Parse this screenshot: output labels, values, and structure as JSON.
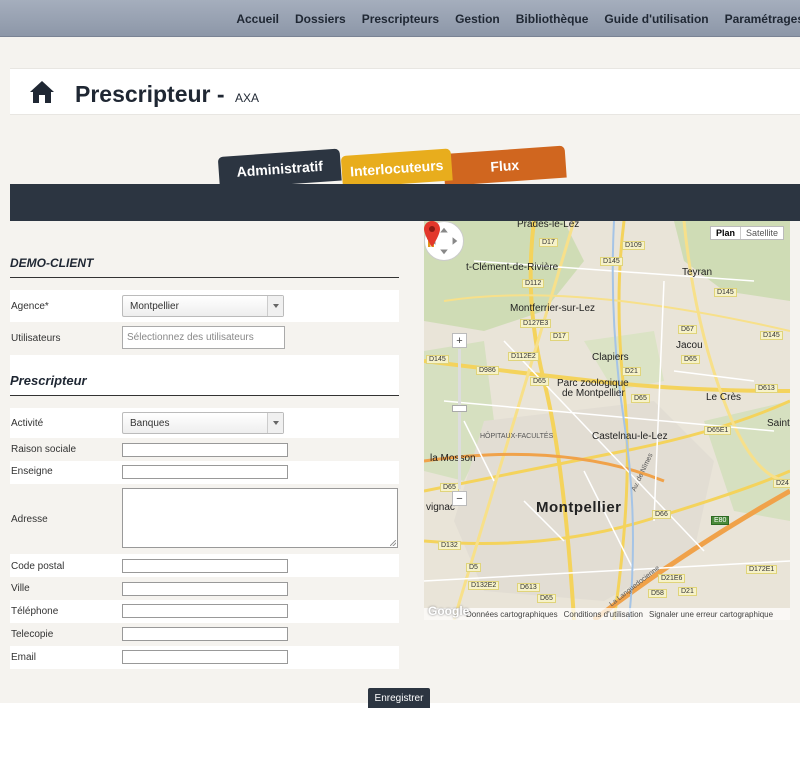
{
  "nav": {
    "items": [
      "Accueil",
      "Dossiers",
      "Prescripteurs",
      "Gestion",
      "Bibliothèque",
      "Guide d'utilisation",
      "Paramétrages"
    ]
  },
  "header": {
    "title": "Prescripteur -",
    "subtitle": "AXA"
  },
  "tabs": [
    "Administratif",
    "Interlocuteurs",
    "Flux"
  ],
  "form": {
    "client_title": "DEMO-CLIENT",
    "agency_label": "Agence*",
    "agency_value": "Montpellier",
    "users_label": "Utilisateurs",
    "users_placeholder": "Sélectionnez des utilisateurs",
    "prescripteur_title": "Prescripteur",
    "activity_label": "Activité",
    "activity_value": "Banques",
    "raison_label": "Raison sociale",
    "enseigne_label": "Enseigne",
    "adresse_label": "Adresse",
    "code_postal_label": "Code postal",
    "ville_label": "Ville",
    "telephone_label": "Téléphone",
    "telecopie_label": "Telecopie",
    "email_label": "Email",
    "save_label": "Enregistrer"
  },
  "map": {
    "type_plan": "Plan",
    "type_satellite": "Satellite",
    "zoom_plus": "+",
    "zoom_minus": "−",
    "google": "Google",
    "footer": [
      "Données cartographiques",
      "Conditions d'utilisation",
      "Signaler une erreur cartographique"
    ],
    "city": "Montpellier",
    "places": [
      {
        "text": "Prades-le-Lez",
        "cls": "mid"
      },
      {
        "text": "t-Clément-de-Rivière",
        "cls": "mid"
      },
      {
        "text": "Teyran",
        "cls": "mid"
      },
      {
        "text": "Montferrier-sur-Lez",
        "cls": "mid"
      },
      {
        "text": "Jacou",
        "cls": "mid"
      },
      {
        "text": "Clapiers",
        "cls": "mid"
      },
      {
        "text": "Parc zoologique",
        "cls": "mid"
      },
      {
        "text": "de Montpellier",
        "cls": "mid"
      },
      {
        "text": "Le Crès",
        "cls": "mid"
      },
      {
        "text": "Castelnau-le-Lez",
        "cls": "mid"
      },
      {
        "text": "Saint",
        "cls": "mid"
      },
      {
        "text": "HÔPITAUX-FACULTÉS",
        "cls": "small"
      },
      {
        "text": "la Mosson",
        "cls": "mid"
      },
      {
        "text": "vignac",
        "cls": "mid"
      },
      {
        "text": "Av. de Nîmes",
        "cls": "small"
      },
      {
        "text": "La Languedocienne",
        "cls": "small"
      }
    ],
    "roads": [
      "D17",
      "D109",
      "D145",
      "D112",
      "D145",
      "D127E3",
      "D17",
      "D67",
      "D145",
      "D112E2",
      "D65",
      "D145",
      "D986",
      "D65",
      "D21",
      "D613",
      "D65",
      "D65E1",
      "D65",
      "D24",
      "D66",
      "D132",
      "E80",
      "D5",
      "D21E6",
      "D132E2",
      "D613",
      "D65",
      "D58",
      "D21",
      "D172E1"
    ]
  }
}
